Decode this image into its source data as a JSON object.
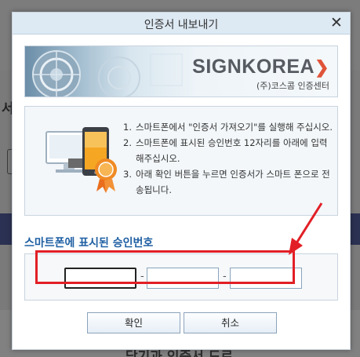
{
  "background": {
    "left_fragment": "서",
    "bottom_text": "당기과 인증서 드로"
  },
  "dialog": {
    "title": "인증서 내보내기",
    "close_label": "✕"
  },
  "banner": {
    "brand_main": "SIGNKOREA",
    "brand_sub": "(주)코스콤 인증센터"
  },
  "instructions": {
    "steps": [
      {
        "num": "1.",
        "text": "스마트폰에서 \"인증서 가져오기\"를 실행해 주십시오."
      },
      {
        "num": "2.",
        "text": "스마트폰에 표시된 승인번호 12자리를 아래에 입력해주십시오."
      },
      {
        "num": "3.",
        "text": "아래 확인 버튼을 누르면 인증서가 스마트 폰으로 전송됩니다."
      }
    ]
  },
  "approval": {
    "title": "스마트폰에 표시된 승인번호",
    "fields": [
      {
        "value": "",
        "placeholder": ""
      },
      {
        "value": "",
        "placeholder": ""
      },
      {
        "value": "",
        "placeholder": ""
      }
    ],
    "separator": "-"
  },
  "buttons": {
    "confirm": "확인",
    "cancel": "취소"
  },
  "colors": {
    "accent_title": "#1f5fa3",
    "highlight": "#e21f26",
    "titlebar": "#dde9f3"
  }
}
